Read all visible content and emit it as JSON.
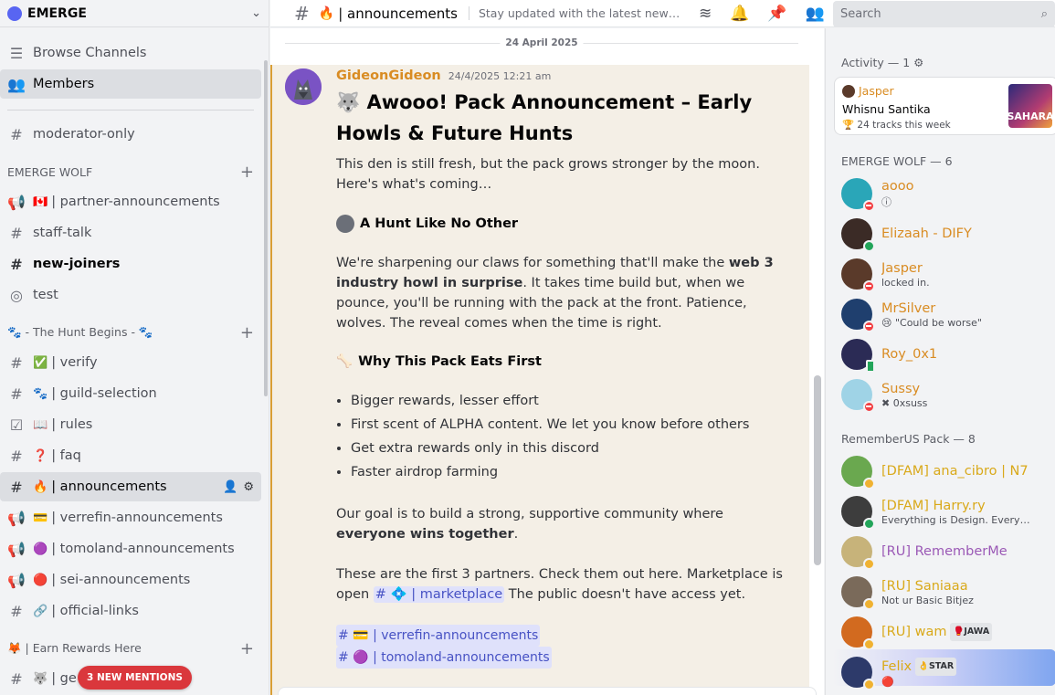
{
  "server": {
    "name": "EMERGE"
  },
  "sidebar": {
    "top_items": [
      {
        "label": "Browse Channels"
      },
      {
        "label": "Members"
      }
    ],
    "moderator": {
      "label": "moderator-only"
    },
    "categories": [
      {
        "label": "EMERGE WOLF"
      },
      {
        "label": "🐾 - The Hunt Begins - 🐾"
      },
      {
        "label": "🦊 | Earn Rewards Here"
      }
    ],
    "wolf_channels": [
      {
        "emoji": "🇨🇦",
        "label": "| partner-announcements"
      },
      {
        "label": "staff-talk"
      },
      {
        "label": "new-joiners"
      },
      {
        "label": "test"
      }
    ],
    "hunt_channels": [
      {
        "emoji": "✅",
        "label": "| verify"
      },
      {
        "emoji": "🐾",
        "label": "| guild-selection"
      },
      {
        "emoji": "📖",
        "label": "| rules"
      },
      {
        "emoji": "❓",
        "label": "| faq"
      },
      {
        "emoji": "🔥",
        "label": "| announcements"
      },
      {
        "emoji": "💳",
        "label": "| verrefin-announcements"
      },
      {
        "emoji": "🟣",
        "label": "| tomoland-announcements"
      },
      {
        "emoji": "🔴",
        "label": "| sei-announcements"
      },
      {
        "emoji": "🔗",
        "label": "| official-links"
      }
    ],
    "rewards_channels": [
      {
        "emoji": "🐺",
        "label": "| ge"
      }
    ],
    "mention_pill": "3 NEW MENTIONS"
  },
  "topbar": {
    "channel_emoji": "🔥",
    "channel_name": "| announcements",
    "topic": "Stay updated with the latest news and announcements",
    "search_placeholder": "Search"
  },
  "chat": {
    "date_divider": "24 April 2025",
    "message": {
      "author": "GideonGideon",
      "timestamp": "24/4/2025 12:21 am",
      "heading": "🐺 Awooo! Pack Announcement – Early Howls & Future Hunts",
      "intro": "This den is still fresh, but the pack grows stronger by the moon. Here's what's coming…",
      "section1_title": "A Hunt Like No Other",
      "section1_p1": "We're sharpening our claws for something that'll make the ",
      "section1_bold": "web 3 industry howl in surprise",
      "section1_p2": ". It takes time build but, when we pounce, you'll be running with the pack at the front. Patience, wolves. The reveal comes when the time is right.",
      "section2_emoji": "🦴",
      "section2_title": "Why This Pack Eats First",
      "bullets": [
        "Bigger rewards, lesser effort",
        "First scent of ALPHA content. We let you know before others",
        "Get extra rewards only in this discord",
        "Faster airdrop farming"
      ],
      "goal_p1": "Our goal is to build a strong, supportive community where ",
      "goal_bold": "everyone wins together",
      "goal_p2": ".",
      "partners_p1": "These are the first 3 partners. Check them out here. Marketplace is open ",
      "marketplace_mention": "# 💠 | marketplace",
      "partners_p2": " The public doesn't have access yet.",
      "channel_mentions": [
        "# 💳 | verrefin-announcements",
        "# 🟣 | tomoland-announcements"
      ]
    }
  },
  "members": {
    "activity_header": "Activity — 1",
    "activity": {
      "user": "Jasper",
      "title": "Whisnu Santika",
      "detail": "24 tracks this week",
      "art_text": "SAHARA"
    },
    "groups": [
      {
        "header": "EMERGE WOLF — 6",
        "members": [
          {
            "name": "aooo",
            "sub": "ⓘ",
            "color": "#d98c23",
            "status": "dnd",
            "avatar": "#2aa6b8"
          },
          {
            "name": "Elizaah - DIFY",
            "sub": "",
            "color": "#d98c23",
            "status": "on",
            "avatar": "#3b2b26"
          },
          {
            "name": "Jasper",
            "sub": "locked in.",
            "color": "#d98c23",
            "status": "dnd",
            "avatar": "#5a3a2a"
          },
          {
            "name": "MrSilver",
            "sub": "😢 \"Could be worse\"",
            "color": "#d98c23",
            "status": "dnd",
            "avatar": "#1f3f6e"
          },
          {
            "name": "Roy_0x1",
            "sub": "",
            "color": "#d98c23",
            "status": "mob",
            "avatar": "#2b2b55"
          },
          {
            "name": "Sussy",
            "sub": "✖ 0xsuss",
            "color": "#d98c23",
            "status": "dnd",
            "avatar": "#9fd3e6"
          }
        ]
      },
      {
        "header": "RememberUS Pack — 8",
        "members": [
          {
            "name": "[DFAM] ana_cibro | N7",
            "sub": "",
            "color": "#d9a91a",
            "status": "idle",
            "avatar": "#6aa84f"
          },
          {
            "name": "[DFAM] Harry.ry",
            "sub": "Everything is Design. Everything is...",
            "color": "#d9a91a",
            "status": "on",
            "avatar": "#3d3d3d"
          },
          {
            "name": "[RU] RememberMe",
            "sub": "",
            "color": "#9b59b6",
            "status": "idle",
            "avatar": "#c7b37a"
          },
          {
            "name": "[RU] Saniaaa",
            "sub": "Not ur Basic Bitjez",
            "color": "#d9a91a",
            "status": "idle",
            "avatar": "#7a6a5a"
          },
          {
            "name": "[RU] wam",
            "sub": "",
            "color": "#d9a91a",
            "status": "idle",
            "avatar": "#d26a1f",
            "tag": "JAWA",
            "tag_emoji": "🥊"
          },
          {
            "name": "Felix",
            "sub": "🔴",
            "color": "#d9a91a",
            "status": "idle",
            "avatar": "#2d3a6a",
            "tag": "STAR",
            "tag_emoji": "👌"
          }
        ]
      }
    ]
  }
}
